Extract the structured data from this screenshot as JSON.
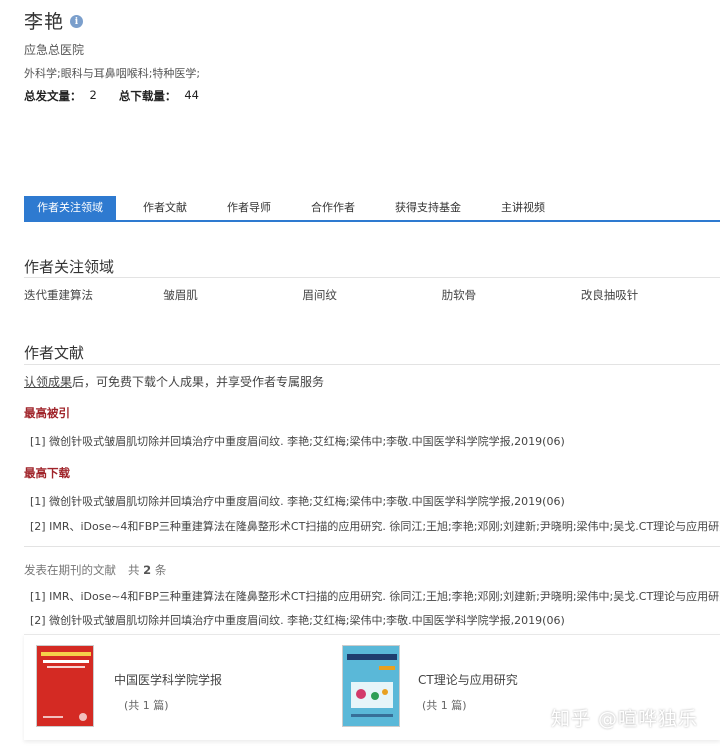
{
  "author": {
    "name": "李艳",
    "info_icon": "i",
    "organization": "应急总医院",
    "fields": "外科学;眼科与耳鼻咽喉科;特种医学;",
    "stats": {
      "publications_label": "总发文量：",
      "publications": "2",
      "downloads_label": "总下载量：",
      "downloads": "44"
    }
  },
  "tabs": [
    {
      "label": "作者关注领域",
      "active": true
    },
    {
      "label": "作者文献"
    },
    {
      "label": "作者导师"
    },
    {
      "label": "合作作者"
    },
    {
      "label": "获得支持基金"
    },
    {
      "label": "主讲视频"
    }
  ],
  "focus": {
    "title": "作者关注领域",
    "keywords": [
      "迭代重建算法",
      "皱眉肌",
      "眉间纹",
      "肋软骨",
      "改良抽吸针"
    ]
  },
  "literature": {
    "title": "作者文献",
    "claim_link": "认领成果",
    "claim_rest": "后，可免费下载个人成果，并享受作者专属服务",
    "most_cited_label": "最高被引",
    "most_cited": [
      "[1] 微创针吸式皱眉肌切除并回填治疗中重度眉间纹. 李艳;艾红梅;梁伟中;李敬.中国医学科学院学报,2019(06)"
    ],
    "most_downloaded_label": "最高下载",
    "most_downloaded": [
      "[1] 微创针吸式皱眉肌切除并回填治疗中重度眉间纹. 李艳;艾红梅;梁伟中;李敬.中国医学科学院学报,2019(06)",
      "[2] IMR、iDose~4和FBP三种重建算法在隆鼻整形术CT扫描的应用研究. 徐同江;王旭;李艳;邓刚;刘建新;尹晓明;梁伟中;吴戈.CT理论与应用研究"
    ],
    "journal_label": "发表在期刊的文献",
    "journal_count_prefix": "共",
    "journal_count": "2",
    "journal_count_suffix": "条",
    "journal_refs": [
      "[1] IMR、iDose~4和FBP三种重建算法在隆鼻整形术CT扫描的应用研究. 徐同江;王旭;李艳;邓刚;刘建新;尹晓明;梁伟中;吴戈.CT理论与应用研究",
      "[2] 微创针吸式皱眉肌切除并回填治疗中重度眉间纹. 李艳;艾红梅;梁伟中;李敬.中国医学科学院学报,2019(06)"
    ]
  },
  "journals": [
    {
      "name": "中国医学科学院学报",
      "count": "(共 1 篇)",
      "cover_color": "#d42a23"
    },
    {
      "name": "CT理论与应用研究",
      "count": "(共 1 篇)",
      "cover_color": "#5ab8d8"
    }
  ],
  "watermark": "知乎 @喧哗独乐"
}
